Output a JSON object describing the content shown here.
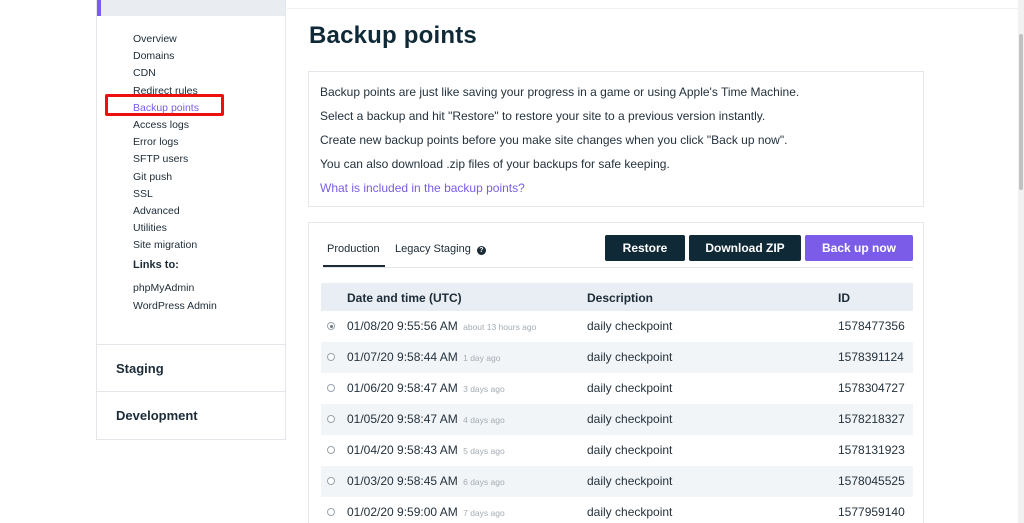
{
  "sidebar": {
    "items": [
      {
        "label": "Overview"
      },
      {
        "label": "Domains"
      },
      {
        "label": "CDN"
      },
      {
        "label": "Redirect rules"
      },
      {
        "label": "Backup points"
      },
      {
        "label": "Access logs"
      },
      {
        "label": "Error logs"
      },
      {
        "label": "SFTP users"
      },
      {
        "label": "Git push"
      },
      {
        "label": "SSL"
      },
      {
        "label": "Advanced"
      },
      {
        "label": "Utilities"
      },
      {
        "label": "Site migration"
      }
    ],
    "active_item": "Backup points",
    "links_heading": "Links to:",
    "links": [
      {
        "label": "phpMyAdmin"
      },
      {
        "label": "WordPress Admin"
      }
    ],
    "sections": [
      {
        "label": "Staging"
      },
      {
        "label": "Development"
      }
    ]
  },
  "main": {
    "title": "Backup points",
    "info_lines": [
      "Backup points are just like saving your progress in a game or using Apple's Time Machine.",
      "Select a backup and hit \"Restore\" to restore your site to a previous version instantly.",
      "Create new backup points before you make site changes when you click \"Back up now\".",
      "You can also download .zip files of your backups for safe keeping."
    ],
    "info_link": "What is included in the backup points?",
    "tabs": [
      {
        "label": "Production"
      },
      {
        "label": "Legacy Staging"
      }
    ],
    "help_glyph": "?",
    "buttons": {
      "restore": "Restore",
      "download_zip": "Download ZIP",
      "back_up_now": "Back up now"
    },
    "table": {
      "headers": [
        "Date and time (UTC)",
        "Description",
        "ID"
      ],
      "rows": [
        {
          "date": "01/08/20 9:55:56 AM",
          "ago": "about 13 hours ago",
          "description": "daily checkpoint",
          "id": "1578477356",
          "selected": true
        },
        {
          "date": "01/07/20 9:58:44 AM",
          "ago": "1 day ago",
          "description": "daily checkpoint",
          "id": "1578391124",
          "selected": false
        },
        {
          "date": "01/06/20 9:58:47 AM",
          "ago": "3 days ago",
          "description": "daily checkpoint",
          "id": "1578304727",
          "selected": false
        },
        {
          "date": "01/05/20 9:58:47 AM",
          "ago": "4 days ago",
          "description": "daily checkpoint",
          "id": "1578218327",
          "selected": false
        },
        {
          "date": "01/04/20 9:58:43 AM",
          "ago": "5 days ago",
          "description": "daily checkpoint",
          "id": "1578131923",
          "selected": false
        },
        {
          "date": "01/03/20 9:58:45 AM",
          "ago": "6 days ago",
          "description": "daily checkpoint",
          "id": "1578045525",
          "selected": false
        },
        {
          "date": "01/02/20 9:59:00 AM",
          "ago": "7 days ago",
          "description": "daily checkpoint",
          "id": "1577959140",
          "selected": false
        }
      ]
    }
  },
  "colors": {
    "accent": "#7b5ce9",
    "dark_button": "#0f2937",
    "highlight": "#ee0f0f"
  }
}
